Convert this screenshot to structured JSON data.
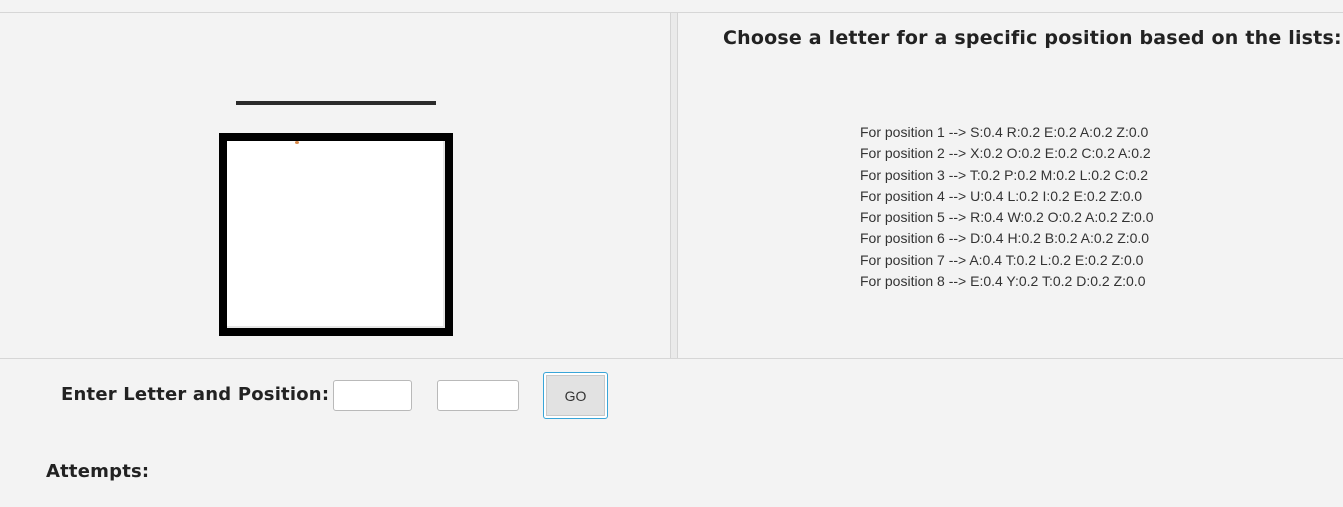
{
  "instructions": {
    "title": "Choose a letter for a specific position based on the lists:",
    "positions": [
      "For position 1 --> S:0.4 R:0.2 E:0.2 A:0.2 Z:0.0",
      "For position 2 --> X:0.2 O:0.2 E:0.2 C:0.2 A:0.2",
      "For position 3 --> T:0.2 P:0.2 M:0.2 L:0.2 C:0.2",
      "For position 4 --> U:0.4 L:0.2 I:0.2 E:0.2 Z:0.0",
      "For position 5 --> R:0.4 W:0.2 O:0.2 A:0.2 Z:0.0",
      "For position 6 --> D:0.4 H:0.2 B:0.2 A:0.2 Z:0.0",
      "For position 7 --> A:0.4 T:0.2 L:0.2 E:0.2 Z:0.0",
      "For position 8 --> E:0.4 Y:0.2 T:0.2 D:0.2 Z:0.0"
    ]
  },
  "guess_form": {
    "label": "Enter Letter and Position:",
    "letter_value": "",
    "position_value": "",
    "go_label": "GO"
  },
  "attempts": {
    "label": "Attempts:"
  }
}
